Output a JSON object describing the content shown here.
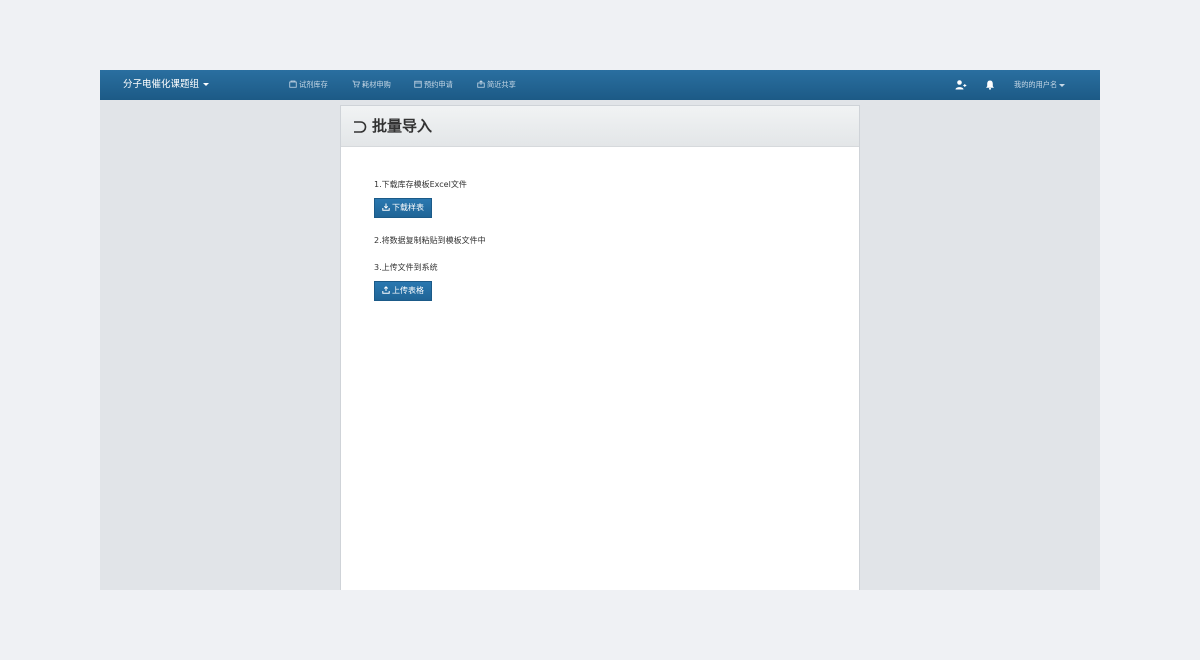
{
  "navbar": {
    "brand": "分子电催化课题组",
    "items": [
      {
        "label": "试剂库存",
        "icon": "box-icon"
      },
      {
        "label": "耗材申购",
        "icon": "cart-icon"
      },
      {
        "label": "预约申请",
        "icon": "calendar-icon"
      },
      {
        "label": "简近共享",
        "icon": "share-icon"
      }
    ],
    "add_user_icon": "add-user-icon",
    "bell_icon": "bell-icon",
    "user_label": "我的的用户名"
  },
  "page": {
    "title": "批量导入",
    "back_icon": "undo-arrow-icon"
  },
  "steps": {
    "step1": "1.下载库存模板Excel文件",
    "download_button": "下载样表",
    "step2": "2.将数据复制粘贴到模板文件中",
    "step3": "3.上传文件到系统",
    "upload_button": "上传表格"
  },
  "colors": {
    "navbar": "#1f5f8c",
    "button": "#236ea3",
    "page_bg": "#eff1f4",
    "app_bg": "#e1e4e8"
  }
}
